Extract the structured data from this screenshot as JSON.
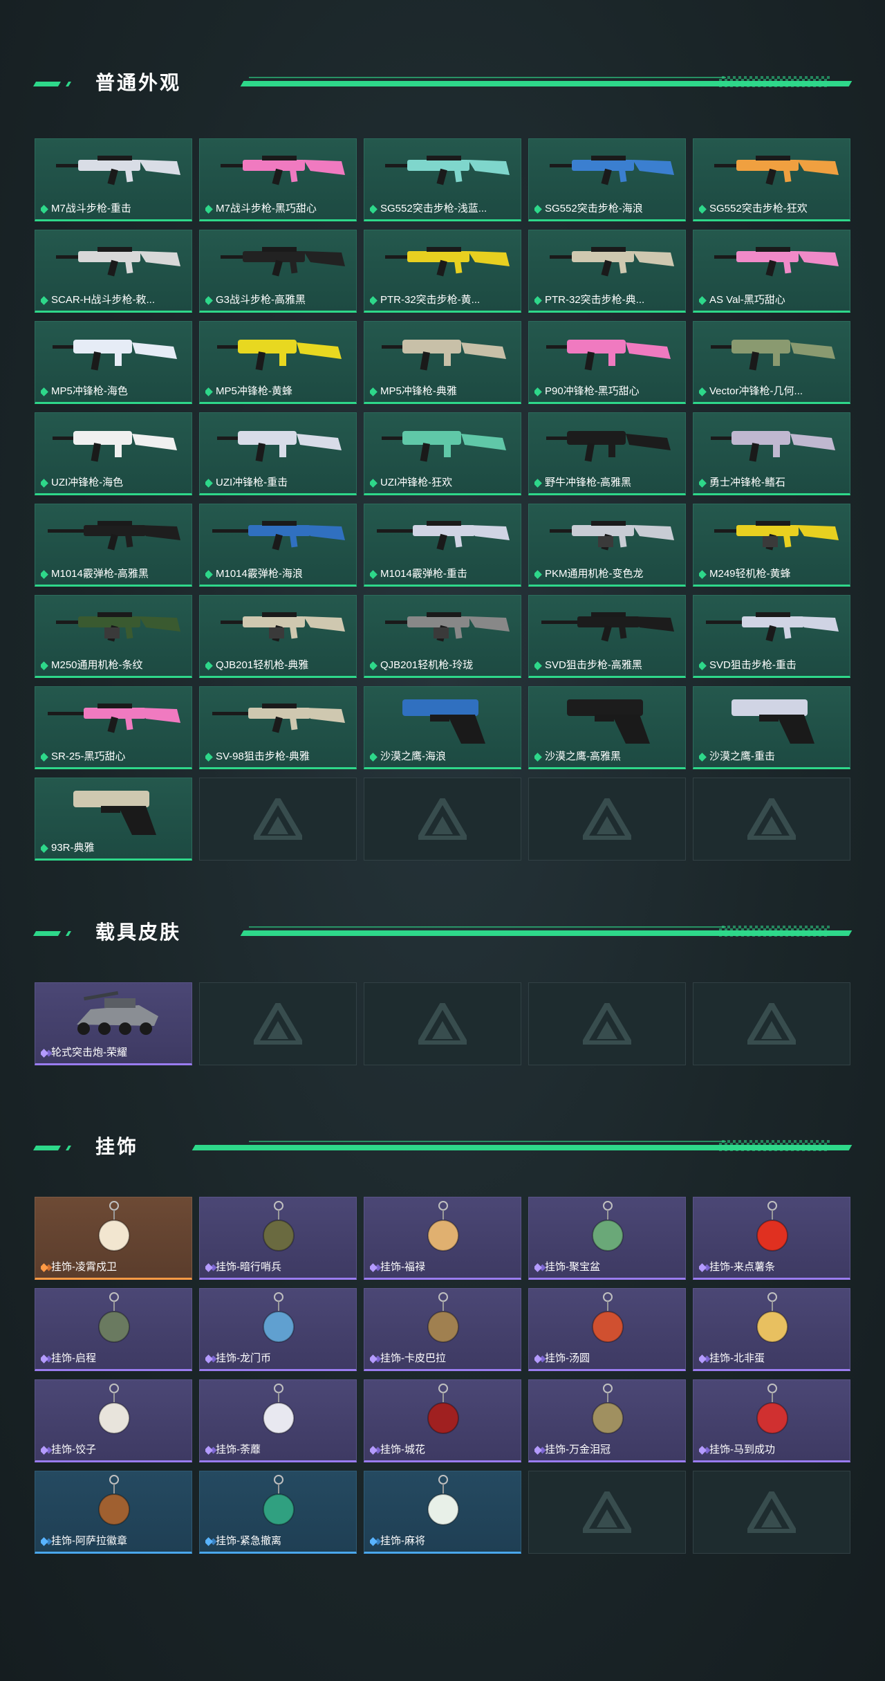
{
  "sections": {
    "skins": {
      "title": "普通外观",
      "items": [
        {
          "label": "M7战斗步枪-重击",
          "rarity": "green",
          "icon": "rifle-icon",
          "color": "#d9dde6"
        },
        {
          "label": "M7战斗步枪-黑巧甜心",
          "rarity": "green",
          "icon": "rifle-icon",
          "color": "#f07ac0"
        },
        {
          "label": "SG552突击步枪-浅蓝...",
          "rarity": "green",
          "icon": "rifle-icon",
          "color": "#7fd6cc"
        },
        {
          "label": "SG552突击步枪-海浪",
          "rarity": "green",
          "icon": "rifle-icon",
          "color": "#3b7fd0"
        },
        {
          "label": "SG552突击步枪-狂欢",
          "rarity": "green",
          "icon": "rifle-icon",
          "color": "#f0a040"
        },
        {
          "label": "SCAR-H战斗步枪-敕...",
          "rarity": "green",
          "icon": "rifle-icon",
          "color": "#d8d8d8"
        },
        {
          "label": "G3战斗步枪-高雅黑",
          "rarity": "green",
          "icon": "rifle-icon",
          "color": "#222222"
        },
        {
          "label": "PTR-32突击步枪-黄...",
          "rarity": "green",
          "icon": "rifle-icon",
          "color": "#e8d020"
        },
        {
          "label": "PTR-32突击步枪-典...",
          "rarity": "green",
          "icon": "rifle-icon",
          "color": "#cfc8b0"
        },
        {
          "label": "AS Val-黑巧甜心",
          "rarity": "green",
          "icon": "rifle-icon",
          "color": "#f08ac8"
        },
        {
          "label": "MP5冲锋枪-海色",
          "rarity": "green",
          "icon": "smg-icon",
          "color": "#e6ecf6"
        },
        {
          "label": "MP5冲锋枪-黄蜂",
          "rarity": "green",
          "icon": "smg-icon",
          "color": "#e8d820"
        },
        {
          "label": "MP5冲锋枪-典雅",
          "rarity": "green",
          "icon": "smg-icon",
          "color": "#c8c0a8"
        },
        {
          "label": "P90冲锋枪-黑巧甜心",
          "rarity": "green",
          "icon": "smg-icon",
          "color": "#f07ac0"
        },
        {
          "label": "Vector冲锋枪-几何...",
          "rarity": "green",
          "icon": "smg-icon",
          "color": "#8a9a70"
        },
        {
          "label": "UZI冲锋枪-海色",
          "rarity": "green",
          "icon": "smg-icon",
          "color": "#f0f0f0"
        },
        {
          "label": "UZI冲锋枪-重击",
          "rarity": "green",
          "icon": "smg-icon",
          "color": "#d8dce8"
        },
        {
          "label": "UZI冲锋枪-狂欢",
          "rarity": "green",
          "icon": "smg-icon",
          "color": "#60c8a8"
        },
        {
          "label": "野牛冲锋枪-高雅黑",
          "rarity": "green",
          "icon": "smg-icon",
          "color": "#1c1c1c"
        },
        {
          "label": "勇士冲锋枪-鳍石",
          "rarity": "green",
          "icon": "smg-icon",
          "color": "#c0b8d0"
        },
        {
          "label": "M1014霰弹枪-高雅黑",
          "rarity": "green",
          "icon": "shotgun-icon",
          "color": "#1e1e1e"
        },
        {
          "label": "M1014霰弹枪-海浪",
          "rarity": "green",
          "icon": "shotgun-icon",
          "color": "#3070c0"
        },
        {
          "label": "M1014霰弹枪-重击",
          "rarity": "green",
          "icon": "shotgun-icon",
          "color": "#d0d4e4"
        },
        {
          "label": "PKM通用机枪-变色龙",
          "rarity": "green",
          "icon": "mg-icon",
          "color": "#c8ccd4"
        },
        {
          "label": "M249轻机枪-黄蜂",
          "rarity": "green",
          "icon": "mg-icon",
          "color": "#e8d020"
        },
        {
          "label": "M250通用机枪-条纹",
          "rarity": "green",
          "icon": "mg-icon",
          "color": "#3a5a30"
        },
        {
          "label": "QJB201轻机枪-典雅",
          "rarity": "green",
          "icon": "mg-icon",
          "color": "#cfc8b0"
        },
        {
          "label": "QJB201轻机枪-玲珑",
          "rarity": "green",
          "icon": "mg-icon",
          "color": ""
        },
        {
          "label": "SVD狙击步枪-高雅黑",
          "rarity": "green",
          "icon": "sniper-icon",
          "color": "#1c1c1c"
        },
        {
          "label": "SVD狙击步枪-重击",
          "rarity": "green",
          "icon": "sniper-icon",
          "color": "#d0d4e4"
        },
        {
          "label": "SR-25-黑巧甜心",
          "rarity": "green",
          "icon": "sniper-icon",
          "color": "#f07ac0"
        },
        {
          "label": "SV-98狙击步枪-典雅",
          "rarity": "green",
          "icon": "sniper-icon",
          "color": "#cfc8b0"
        },
        {
          "label": "沙漠之鹰-海浪",
          "rarity": "green",
          "icon": "pistol-icon",
          "color": "#3070c0"
        },
        {
          "label": "沙漠之鹰-高雅黑",
          "rarity": "green",
          "icon": "pistol-icon",
          "color": "#1c1c1c"
        },
        {
          "label": "沙漠之鹰-重击",
          "rarity": "green",
          "icon": "pistol-icon",
          "color": "#d0d4e4"
        },
        {
          "label": "93R-典雅",
          "rarity": "green",
          "icon": "pistol-icon",
          "color": "#cfc8b0"
        }
      ],
      "empty_count": 4
    },
    "vehicles": {
      "title": "载具皮肤",
      "items": [
        {
          "label": "轮式突击炮-荣耀",
          "rarity": "purple",
          "icon": "vehicle-icon",
          "color": "#8a8e94"
        }
      ],
      "empty_count": 4
    },
    "charms": {
      "title": "挂饰",
      "items": [
        {
          "label": "挂饰-凌霄戍卫",
          "rarity": "orange",
          "icon": "charm-icon",
          "color": "#f2e6d0"
        },
        {
          "label": "挂饰-暗行哨兵",
          "rarity": "purple",
          "icon": "charm-icon",
          "color": "#6a6a40"
        },
        {
          "label": "挂饰-福禄",
          "rarity": "purple",
          "icon": "charm-icon",
          "color": "#e0b070"
        },
        {
          "label": "挂饰-聚宝盆",
          "rarity": "purple",
          "icon": "charm-icon",
          "color": "#6aa878"
        },
        {
          "label": "挂饰-来点薯条",
          "rarity": "purple",
          "icon": "charm-icon",
          "color": "#e03020"
        },
        {
          "label": "挂饰-启程",
          "rarity": "purple",
          "icon": "charm-icon",
          "color": "#6a7a60"
        },
        {
          "label": "挂饰-龙门币",
          "rarity": "purple",
          "icon": "charm-icon",
          "color": "#60a0d0"
        },
        {
          "label": "挂饰-卡皮巴拉",
          "rarity": "purple",
          "icon": "charm-icon",
          "color": "#a08050"
        },
        {
          "label": "挂饰-汤圆",
          "rarity": "purple",
          "icon": "charm-icon",
          "color": "#d05030"
        },
        {
          "label": "挂饰-北非蛋",
          "rarity": "purple",
          "icon": "charm-icon",
          "color": "#e8c060"
        },
        {
          "label": "挂饰-饺子",
          "rarity": "purple",
          "icon": "charm-icon",
          "color": "#e8e4dc"
        },
        {
          "label": "挂饰-荼蘼",
          "rarity": "purple",
          "icon": "charm-icon",
          "color": "#e8e8f0"
        },
        {
          "label": "挂饰-城花",
          "rarity": "purple",
          "icon": "charm-icon",
          "color": "#a02020"
        },
        {
          "label": "挂饰-万金泪冠",
          "rarity": "purple",
          "icon": "charm-icon",
          "color": "#a09060"
        },
        {
          "label": "挂饰-马到成功",
          "rarity": "purple",
          "icon": "charm-icon",
          "color": "#d03030"
        },
        {
          "label": "挂饰-阿萨拉徽章",
          "rarity": "blue",
          "icon": "charm-icon",
          "color": "#a06030"
        },
        {
          "label": "挂饰-紧急撤离",
          "rarity": "blue",
          "icon": "charm-icon",
          "color": "#30a080"
        },
        {
          "label": "挂饰-麻将",
          "rarity": "blue",
          "icon": "charm-icon",
          "color": "#e8f0e8"
        }
      ],
      "empty_count": 2
    }
  }
}
